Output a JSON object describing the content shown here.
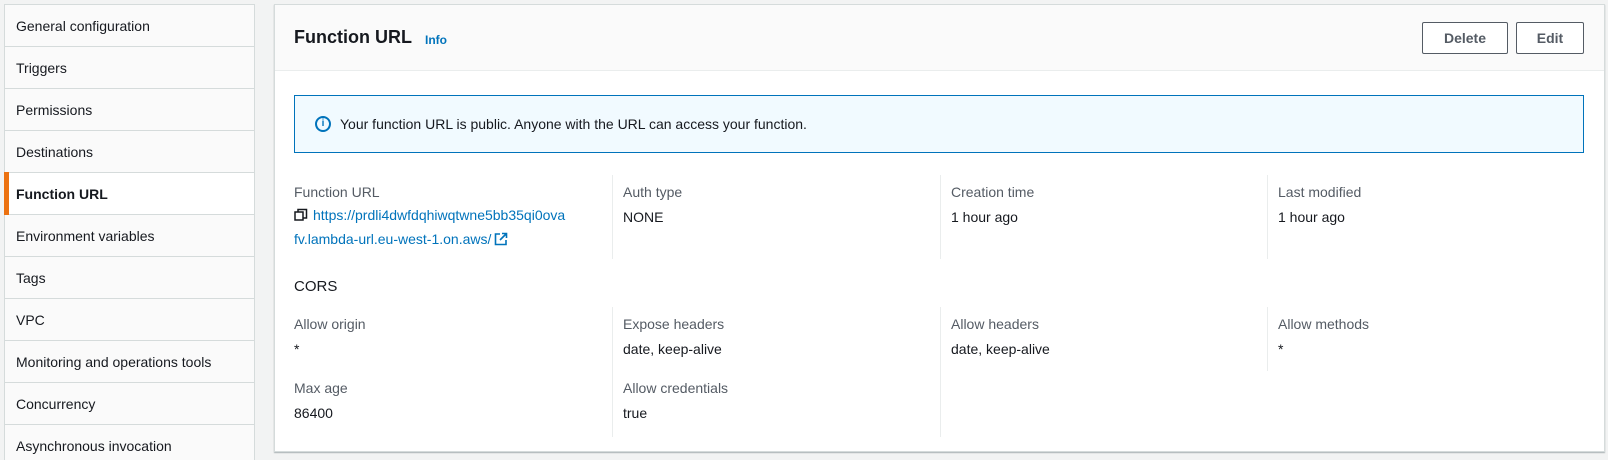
{
  "sidebar": {
    "items": [
      {
        "label": "General configuration",
        "active": false
      },
      {
        "label": "Triggers",
        "active": false
      },
      {
        "label": "Permissions",
        "active": false
      },
      {
        "label": "Destinations",
        "active": false
      },
      {
        "label": "Function URL",
        "active": true
      },
      {
        "label": "Environment variables",
        "active": false
      },
      {
        "label": "Tags",
        "active": false
      },
      {
        "label": "VPC",
        "active": false
      },
      {
        "label": "Monitoring and operations tools",
        "active": false
      },
      {
        "label": "Concurrency",
        "active": false
      },
      {
        "label": "Asynchronous invocation",
        "active": false
      }
    ]
  },
  "panel": {
    "title": "Function URL",
    "info_label": "Info",
    "delete_label": "Delete",
    "edit_label": "Edit",
    "alert_text": "Your function URL is public. Anyone with the URL can access your function.",
    "details": {
      "function_url_label": "Function URL",
      "function_url_line1": "https://prdli4dwfdqhiwqtwne5bb35qi0ova",
      "function_url_line2": "fv.lambda-url.eu-west-1.on.aws/",
      "auth_type_label": "Auth type",
      "auth_type_value": "NONE",
      "creation_time_label": "Creation time",
      "creation_time_value": "1 hour ago",
      "last_modified_label": "Last modified",
      "last_modified_value": "1 hour ago"
    },
    "cors": {
      "title": "CORS",
      "allow_origin_label": "Allow origin",
      "allow_origin_value": "*",
      "expose_headers_label": "Expose headers",
      "expose_headers_value": "date, keep-alive",
      "allow_headers_label": "Allow headers",
      "allow_headers_value": "date, keep-alive",
      "allow_methods_label": "Allow methods",
      "allow_methods_value": "*",
      "max_age_label": "Max age",
      "max_age_value": "86400",
      "allow_credentials_label": "Allow credentials",
      "allow_credentials_value": "true"
    }
  },
  "colors": {
    "accent": "#ec7211",
    "link": "#0073bb",
    "alert_bg": "#f1faff"
  }
}
